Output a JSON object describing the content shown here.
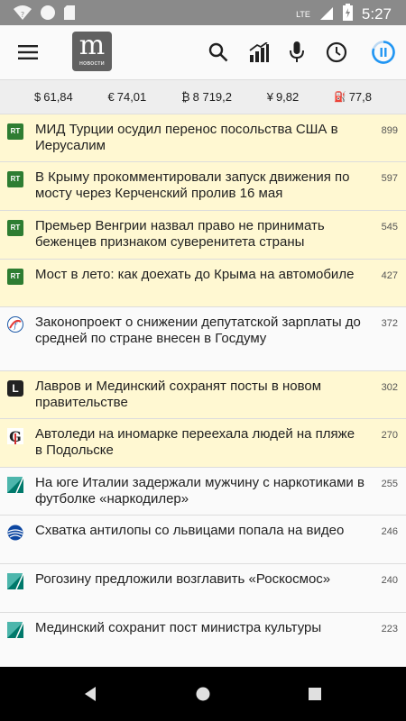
{
  "status_bar": {
    "network": "LTE",
    "time": "5:27"
  },
  "app_bar": {
    "logo_letter": "m",
    "logo_subtitle": "новости"
  },
  "currency": [
    {
      "symbol": "$",
      "value": "61,84"
    },
    {
      "symbol": "€",
      "value": "74,01"
    },
    {
      "symbol": "₿",
      "value": "8 719,2"
    },
    {
      "symbol": "¥",
      "value": "9,82"
    },
    {
      "symbol": "⛽",
      "value": "77,8"
    }
  ],
  "news": [
    {
      "source_icon": "rt-icon",
      "title": "МИД Турции осудил перенос посольства США в Иерусалим",
      "count": "899",
      "highlight": true
    },
    {
      "source_icon": "rt-icon",
      "title": "В Крыму прокомментировали запуск движения по мосту через Керченский пролив 16 мая",
      "count": "597",
      "highlight": true
    },
    {
      "source_icon": "rt-icon",
      "title": "Премьер Венгрии назвал право не принимать беженцев признаком суверенитета страны",
      "count": "545",
      "highlight": true
    },
    {
      "source_icon": "rt-icon",
      "title": "Мост в лето: как доехать до Крыма на автомобиле",
      "count": "427",
      "highlight": true
    },
    {
      "source_icon": "finance-icon",
      "title": "Законопроект о снижении депутатской зарплаты до средней по стране внесен в Госдуму",
      "count": "372",
      "highlight": false
    },
    {
      "source_icon": "lenta-icon",
      "title": "Лавров и Мединский сохранят посты в новом правительстве",
      "count": "302",
      "highlight": true
    },
    {
      "source_icon": "gazeta-icon",
      "title": "Автоледи на иномарке переехала людей на пляже в Подольске",
      "count": "270",
      "highlight": true
    },
    {
      "source_icon": "triangle-icon",
      "title": "На юге Италии задержали мужчину с наркотиками в футболке «наркодилер»",
      "count": "255",
      "highlight": false
    },
    {
      "source_icon": "globe-icon",
      "title": "Схватка антилопы со львицами попала на видео",
      "count": "246",
      "highlight": false
    },
    {
      "source_icon": "triangle-icon",
      "title": "Рогозину предложили возглавить «Роскосмос»",
      "count": "240",
      "highlight": false
    },
    {
      "source_icon": "triangle-icon",
      "title": "Мединский сохранит пост министра культуры",
      "count": "223",
      "highlight": false
    }
  ],
  "colors": {
    "highlight_bg": "#fff8d2",
    "rt_green": "#2e7d32",
    "accent_blue": "#2196f3"
  }
}
